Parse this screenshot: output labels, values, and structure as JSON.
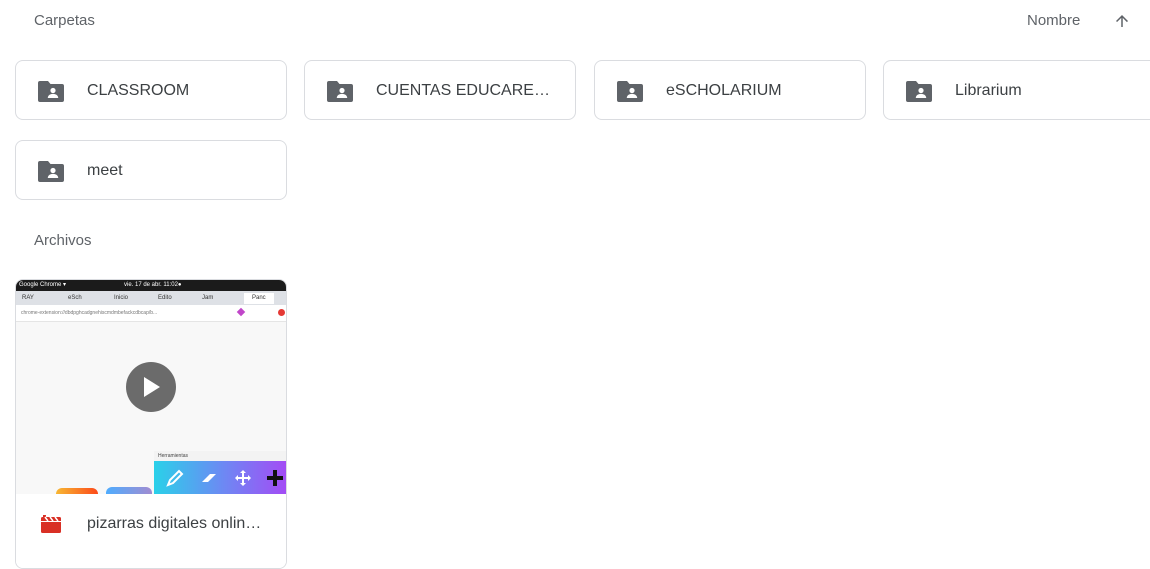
{
  "folders_section": {
    "title": "Carpetas"
  },
  "sort": {
    "label": "Nombre",
    "direction": "ascending",
    "icon": "arrow-up-icon"
  },
  "folders": [
    {
      "name": "CLASSROOM",
      "icon": "shared-folder-icon"
    },
    {
      "name": "CUENTAS EDUCAREX/…",
      "icon": "shared-folder-icon"
    },
    {
      "name": "eSCHOLARIUM",
      "icon": "shared-folder-icon"
    },
    {
      "name": "Librarium",
      "icon": "shared-folder-icon"
    },
    {
      "name": "meet",
      "icon": "shared-folder-icon"
    }
  ],
  "files_section": {
    "title": "Archivos"
  },
  "files": [
    {
      "name": "pizarras digitales onlin…",
      "type_icon": "video-file-icon",
      "type_color": "#d93025",
      "thumbnail": {
        "top_bar": "Google Chrome ▾",
        "top_bar_date": "vie. 17 de abr. 11:02●",
        "tabs": [
          "RAY",
          "eSch",
          "Inicio",
          "Edito",
          "Jam",
          "Panc"
        ],
        "address": "chrome-extension://dbdpghcadgnehiscmdmbefackcdbcap/b...",
        "panel_title": "Herramientas"
      }
    }
  ],
  "colors": {
    "folder_icon": "#5f6368",
    "border": "#dadce0",
    "text": "#3c4043"
  }
}
